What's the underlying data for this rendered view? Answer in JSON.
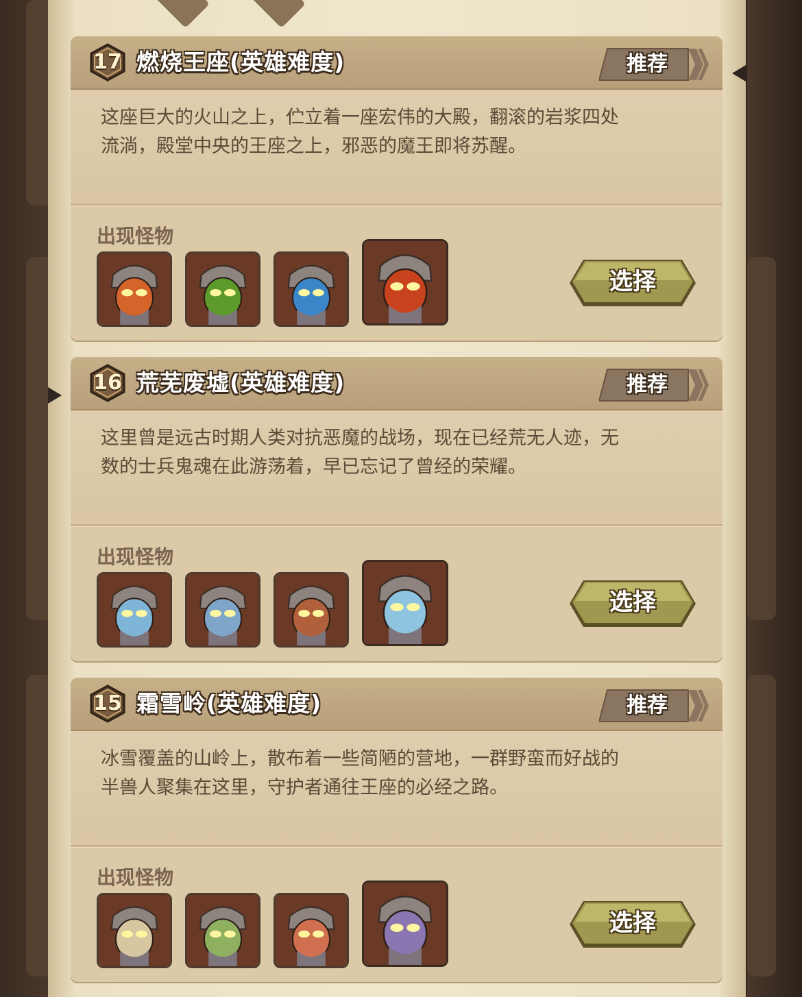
{
  "stages": [
    {
      "level": "17",
      "title": "燃烧王座(英雄难度)",
      "recommend_label": "推荐",
      "description_line1": "这座巨大的火山之上，伫立着一座宏伟的大殿，翻滚的岩浆四处",
      "description_line2": "流淌，殿堂中央的王座之上，邪恶的魔王即将苏醒。",
      "monsters_label": "出现怪物",
      "monsters": [
        "armored-demon-orange",
        "armored-demon-green",
        "armored-demon-blue",
        "demon-king-boss"
      ],
      "monster_colors": [
        "#d5642a",
        "#5c9a2a",
        "#3a86c8",
        "#c8421e"
      ],
      "select_label": "选择"
    },
    {
      "level": "16",
      "title": "荒芜废墟(英雄难度)",
      "recommend_label": "推荐",
      "description_line1": "这里曾是远古时期人类对抗恶魔的战场，现在已经荒无人迹，无",
      "description_line2": "数的士兵鬼魂在此游荡着，早已忘记了曾经的荣耀。",
      "monsters_label": "出现怪物",
      "monsters": [
        "ghost-knight",
        "ghost-hooded",
        "ghost-soldier",
        "ghost-lord-boss"
      ],
      "monster_colors": [
        "#7fb6d8",
        "#7fa6c8",
        "#b0603a",
        "#8fc4e0"
      ],
      "select_label": "选择"
    },
    {
      "level": "15",
      "title": "霜雪岭(英雄难度)",
      "recommend_label": "推荐",
      "description_line1": "冰雪覆盖的山岭上，散布着一些简陋的营地，一群野蛮而好战的",
      "description_line2": "半兽人聚集在这里，守护者通往王座的必经之路。",
      "monsters_label": "出现怪物",
      "monsters": [
        "orc-pale",
        "orc-green",
        "orc-red",
        "orc-chief-boss"
      ],
      "monster_colors": [
        "#d8c6a0",
        "#8fb060",
        "#d07050",
        "#8a76b0"
      ],
      "select_label": "选择"
    }
  ],
  "colors": {
    "parchment": "#efe6cc",
    "card_body": "#dcc9a8",
    "header": "#c0a982",
    "button_olive": "#8e8a3e",
    "text_brown": "#5e4a38"
  }
}
